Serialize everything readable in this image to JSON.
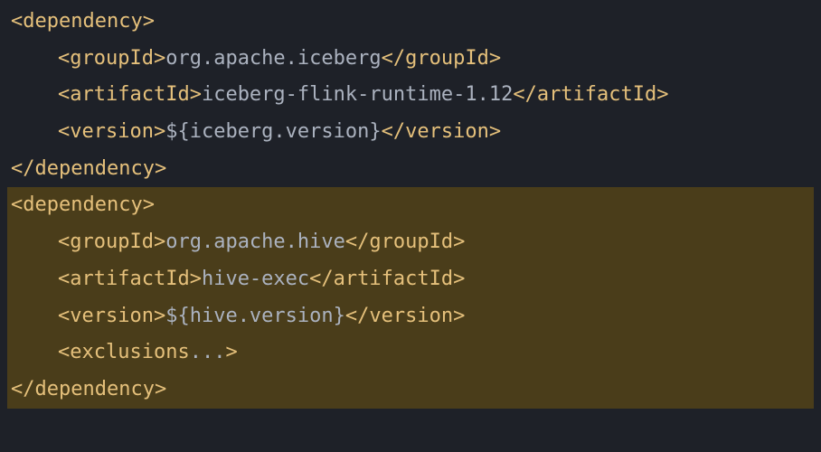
{
  "lines": [
    {
      "level": 0,
      "highlighted": false,
      "segments": [
        {
          "type": "tag",
          "text": "<dependency>"
        }
      ]
    },
    {
      "level": 1,
      "highlighted": false,
      "segments": [
        {
          "type": "tag",
          "text": "<groupId>"
        },
        {
          "type": "text",
          "text": "org.apache.iceberg"
        },
        {
          "type": "tag",
          "text": "</groupId>"
        }
      ]
    },
    {
      "level": 1,
      "highlighted": false,
      "segments": [
        {
          "type": "tag",
          "text": "<artifactId>"
        },
        {
          "type": "text",
          "text": "iceberg-flink-runtime-1.12"
        },
        {
          "type": "tag",
          "text": "</artifactId>"
        }
      ]
    },
    {
      "level": 1,
      "highlighted": false,
      "segments": [
        {
          "type": "tag",
          "text": "<version>"
        },
        {
          "type": "text",
          "text": "${iceberg.version}"
        },
        {
          "type": "tag",
          "text": "</version>"
        }
      ]
    },
    {
      "level": 0,
      "highlighted": false,
      "segments": [
        {
          "type": "tag",
          "text": "</dependency>"
        }
      ]
    },
    {
      "level": 0,
      "highlighted": true,
      "segments": [
        {
          "type": "tag",
          "text": "<dependency>"
        }
      ]
    },
    {
      "level": 1,
      "highlighted": true,
      "segments": [
        {
          "type": "tag",
          "text": "<groupId>"
        },
        {
          "type": "text",
          "text": "org.apache.hive"
        },
        {
          "type": "tag",
          "text": "</groupId>"
        }
      ]
    },
    {
      "level": 1,
      "highlighted": true,
      "segments": [
        {
          "type": "tag",
          "text": "<artifactId>"
        },
        {
          "type": "text",
          "text": "hive-exec"
        },
        {
          "type": "tag",
          "text": "</artifactId>"
        }
      ]
    },
    {
      "level": 1,
      "highlighted": true,
      "segments": [
        {
          "type": "tag",
          "text": "<version>"
        },
        {
          "type": "text",
          "text": "${hive.version}"
        },
        {
          "type": "tag",
          "text": "</version>"
        }
      ]
    },
    {
      "level": 1,
      "highlighted": true,
      "segments": [
        {
          "type": "tag",
          "text": "<exclusions"
        },
        {
          "type": "folded",
          "text": "..."
        },
        {
          "type": "tag",
          "text": ">"
        }
      ]
    },
    {
      "level": 0,
      "highlighted": true,
      "segments": [
        {
          "type": "tag",
          "text": "</dependency>"
        }
      ]
    }
  ]
}
